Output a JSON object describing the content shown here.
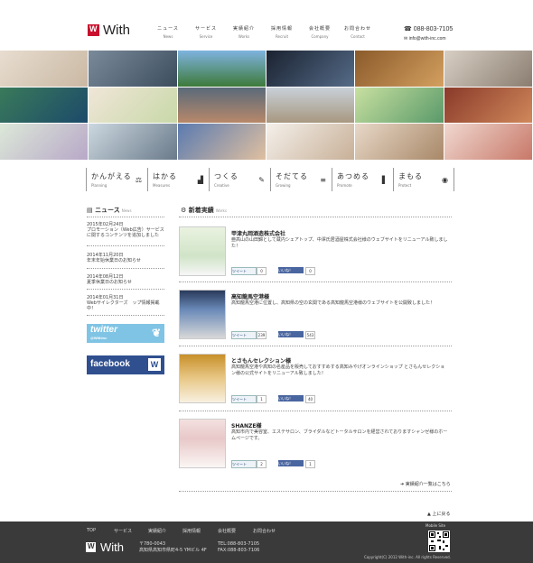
{
  "header": {
    "logo_text": "With",
    "nav": [
      {
        "jp": "ニュース",
        "en": "News"
      },
      {
        "jp": "サービス",
        "en": "Service"
      },
      {
        "jp": "実績紹介",
        "en": "Works"
      },
      {
        "jp": "採用情報",
        "en": "Recruit"
      },
      {
        "jp": "会社概要",
        "en": "Company"
      },
      {
        "jp": "お問合わせ",
        "en": "Contact"
      }
    ],
    "phone": "088-803-7105",
    "email": "info@with-inc.com"
  },
  "categories": [
    {
      "jp": "かんがえる",
      "en": "Planning",
      "icon": "⚖"
    },
    {
      "jp": "はかる",
      "en": "Measures",
      "icon": "▟"
    },
    {
      "jp": "つくる",
      "en": "Creative",
      "icon": "✎"
    },
    {
      "jp": "そだてる",
      "en": "Growing",
      "icon": "≡"
    },
    {
      "jp": "あつめる",
      "en": "Promote",
      "icon": "▌"
    },
    {
      "jp": "まもる",
      "en": "Protect",
      "icon": "◉"
    }
  ],
  "sidebar": {
    "title": "ニュース",
    "title_en": "News",
    "news": [
      {
        "date": "2015年02月24日",
        "text": "プロモーション（Web広告）サービスに関するコンテンツを追加しました"
      },
      {
        "date": "2014年11月20日",
        "text": "年末年始休業日のお知らせ"
      },
      {
        "date": "2014年08月12日",
        "text": "夏季休業日のお知らせ"
      },
      {
        "date": "2014年01月31日",
        "text": "Webサイレクターズ　ップ情報掲載中！"
      }
    ],
    "twitter_label": "twitter",
    "twitter_sub": "@Withinc",
    "facebook_label": "facebook"
  },
  "works": {
    "title": "新着実績",
    "title_en": "Works",
    "items": [
      {
        "title": "甲津丸岡酒造株式会社",
        "desc": "亜高山の山田錦として蔵内シェアトップ、中澤氏居酒屋株式会社様のウェブサイトをリニューアル致しました！",
        "tweet": "ツイート",
        "tw_count": "0",
        "like": "いいね！",
        "fb_count": "0"
      },
      {
        "title": "高知龍馬空港様",
        "desc": "高知龍馬空港に位置し、高知県の空の玄関である高知龍馬空港様のウェブサイトを公開致しました！",
        "tweet": "ツイート",
        "tw_count": "239",
        "like": "いいね！",
        "fb_count": "543"
      },
      {
        "title": "とさもんセレクション様",
        "desc": "高知龍馬空港や高知の名産品を販売しておすすめする高知みやげオンラインショップ とさもんセレクション様の公式サイトをリニューアル致しました！",
        "tweet": "ツイート",
        "tw_count": "1",
        "like": "いいね！",
        "fb_count": "40"
      },
      {
        "title": "SHANZE様",
        "desc": "高知市内で美容室、エステサロン、ブライダルなどトータルサロンを経営されておりますシャンゼ様のホームページです。",
        "tweet": "ツイート",
        "tw_count": "2",
        "like": "いいね！",
        "fb_count": "1"
      }
    ],
    "more": "実績紹介一覧はこちら"
  },
  "to_top": "上に戻る",
  "footer": {
    "nav": [
      "TOP",
      "サービス",
      "実績紹介",
      "採用情報",
      "会社概要",
      "お問合わせ"
    ],
    "logo_text": "With",
    "postal": "〒780-0043",
    "address": "高知県高知市県町4-5 YMビル 4F",
    "tel": "TEL:088-803-7105",
    "fax": "FAX:088-803-7106",
    "mobile_label": "Mobile Site",
    "copyright": "Copyright(C) 2012 With-inc. All rights Reserved."
  },
  "colors": {
    "brand_red": "#c8102e",
    "footer_bg": "#3a3a3a",
    "twitter": "#7fc4e4",
    "facebook": "#2f4f8f"
  }
}
